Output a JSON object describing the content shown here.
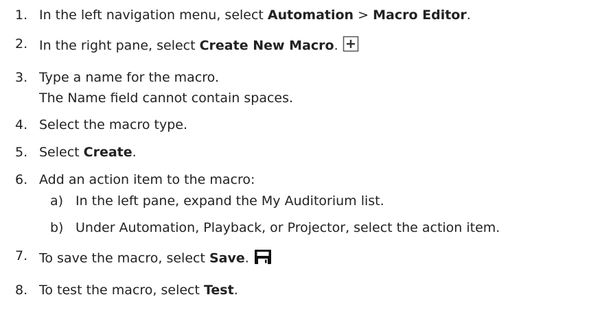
{
  "steps": [
    {
      "num": "1.",
      "pre": "In the left navigation menu, select ",
      "b1": "Automation",
      "mid": " > ",
      "b2": "Macro Editor",
      "post": "."
    },
    {
      "num": "2.",
      "pre": "In the right pane, select ",
      "b1": "Create New Macro",
      "post": ".",
      "icon": "plus-box-icon"
    },
    {
      "num": "3.",
      "text": "Type a name for the macro.",
      "note": "The Name field cannot contain spaces."
    },
    {
      "num": "4.",
      "text": "Select the macro type."
    },
    {
      "num": "5.",
      "pre": "Select ",
      "b1": "Create",
      "post": "."
    },
    {
      "num": "6.",
      "text": "Add an action item to the macro:",
      "substeps": [
        {
          "num": "a)",
          "text": "In the left pane, expand the My Auditorium list."
        },
        {
          "num": "b)",
          "text": "Under Automation, Playback, or Projector, select the action item."
        }
      ]
    },
    {
      "num": "7.",
      "pre": "To save the macro, select ",
      "b1": "Save",
      "post": ".",
      "icon": "floppy-disk-icon"
    },
    {
      "num": "8.",
      "pre": "To test the macro, select ",
      "b1": "Test",
      "post": "."
    }
  ]
}
